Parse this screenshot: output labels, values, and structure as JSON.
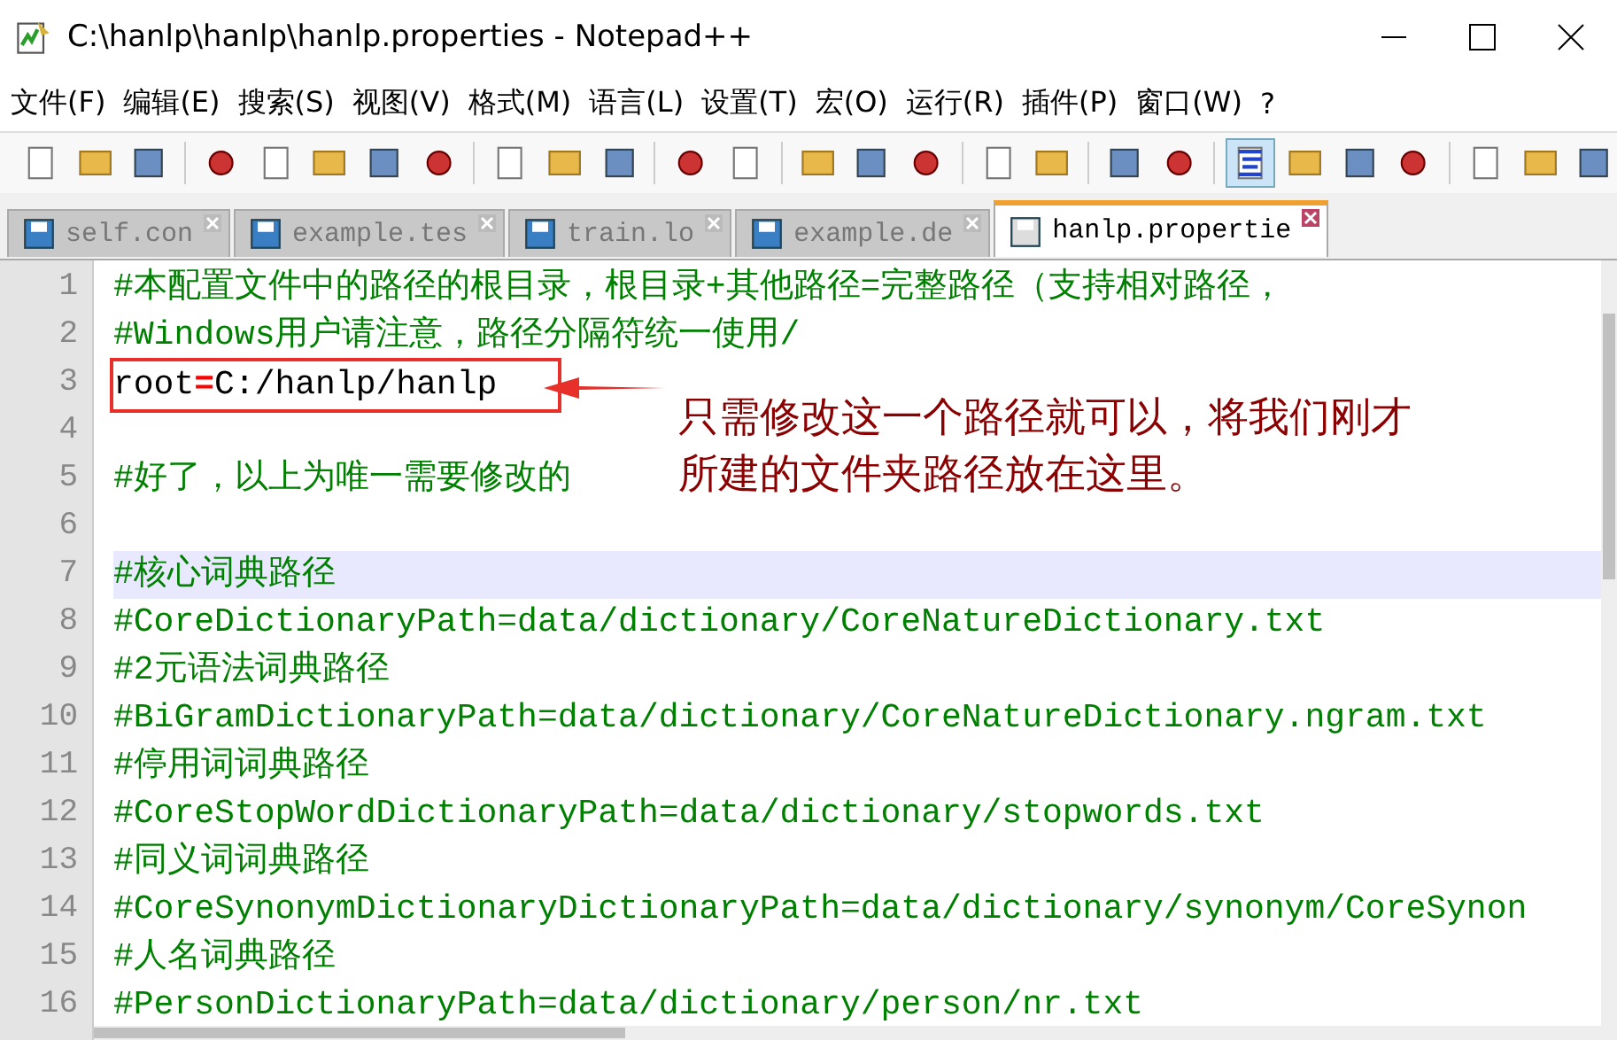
{
  "window": {
    "title": "C:\\hanlp\\hanlp\\hanlp.properties - Notepad++"
  },
  "menu": [
    "文件(F)",
    "编辑(E)",
    "搜索(S)",
    "视图(V)",
    "格式(M)",
    "语言(L)",
    "设置(T)",
    "宏(O)",
    "运行(R)",
    "插件(P)",
    "窗口(W)",
    "?"
  ],
  "toolbar": [
    {
      "pressed": false
    },
    {
      "pressed": false
    },
    {
      "pressed": false
    },
    {
      "pressed": false
    },
    {
      "pressed": false
    },
    {
      "pressed": false
    },
    {
      "pressed": false
    },
    {
      "pressed": false
    },
    {
      "pressed": false
    },
    {
      "pressed": false
    },
    {
      "pressed": false
    },
    {
      "pressed": false
    },
    {
      "pressed": false
    },
    {
      "pressed": false
    },
    {
      "pressed": false
    },
    {
      "pressed": false
    },
    {
      "pressed": false
    },
    {
      "pressed": false
    },
    {
      "pressed": false
    },
    {
      "pressed": false
    },
    {
      "pressed": true
    },
    {
      "pressed": false
    },
    {
      "pressed": false
    },
    {
      "pressed": false
    },
    {
      "pressed": false
    },
    {
      "pressed": false
    },
    {
      "pressed": false
    }
  ],
  "tabs": [
    {
      "label": "self.con",
      "selected": false
    },
    {
      "label": "example.tes",
      "selected": false
    },
    {
      "label": "train.lo",
      "selected": false
    },
    {
      "label": "example.de",
      "selected": false
    },
    {
      "label": "hanlp.propertie",
      "selected": true
    }
  ],
  "lines": [
    {
      "number": "1",
      "kind": "comment",
      "text": "#本配置文件中的路径的根目录，根目录+其他路径=完整路径（支持相对路径，",
      "current": false
    },
    {
      "number": "2",
      "kind": "comment",
      "text": "#Windows用户请注意，路径分隔符统一使用/",
      "current": false
    },
    {
      "number": "3",
      "kind": "property",
      "key": "root",
      "operator": "=",
      "value": "C:/hanlp/hanlp",
      "current": false,
      "boxed": true
    },
    {
      "number": "4",
      "kind": "blank",
      "current": false
    },
    {
      "number": "5",
      "kind": "comment",
      "text": "#好了，以上为唯一需要修改的",
      "current": false
    },
    {
      "number": "6",
      "kind": "blank",
      "current": false
    },
    {
      "number": "7",
      "kind": "comment",
      "text": "#核心词典路径",
      "current": true
    },
    {
      "number": "8",
      "kind": "comment",
      "text": "#CoreDictionaryPath=data/dictionary/CoreNatureDictionary.txt",
      "current": false
    },
    {
      "number": "9",
      "kind": "comment",
      "text": "#2元语法词典路径",
      "current": false
    },
    {
      "number": "10",
      "kind": "comment",
      "text": "#BiGramDictionaryPath=data/dictionary/CoreNatureDictionary.ngram.txt",
      "current": false
    },
    {
      "number": "11",
      "kind": "comment",
      "text": "#停用词词典路径",
      "current": false
    },
    {
      "number": "12",
      "kind": "comment",
      "text": "#CoreStopWordDictionaryPath=data/dictionary/stopwords.txt",
      "current": false
    },
    {
      "number": "13",
      "kind": "comment",
      "text": "#同义词词典路径",
      "current": false
    },
    {
      "number": "14",
      "kind": "comment",
      "text": "#CoreSynonymDictionaryDictionaryPath=data/dictionary/synonym/CoreSynon",
      "current": false
    },
    {
      "number": "15",
      "kind": "comment",
      "text": "#人名词典路径",
      "current": false
    },
    {
      "number": "16",
      "kind": "comment",
      "text": "#PersonDictionaryPath=data/dictionary/person/nr.txt",
      "current": false
    }
  ],
  "annotation": {
    "lines": [
      "只需修改这一个路径就可以，将我们刚才",
      "所建的文件夹路径放在这里。"
    ]
  }
}
